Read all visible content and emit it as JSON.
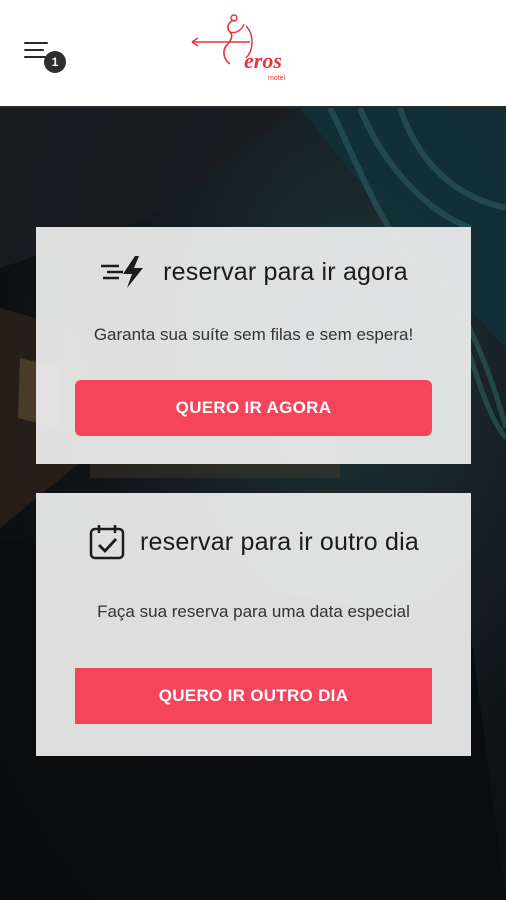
{
  "header": {
    "menu_icon": "menu-icon",
    "notification_count": "1",
    "logo_text": "eros",
    "logo_subtext": "motel",
    "brand_color": "#e4333c"
  },
  "cards": [
    {
      "icon": "lightning-speed-icon",
      "title": "reservar para ir agora",
      "subtitle": "Garanta sua suíte sem filas e sem espera!",
      "button_label": "QUERO IR AGORA"
    },
    {
      "icon": "calendar-check-icon",
      "title": "reservar para ir outro dia",
      "subtitle": "Faça sua reserva para uma data especial",
      "button_label": "QUERO IR OUTRO DIA"
    }
  ],
  "colors": {
    "accent": "#f5455b",
    "card_bg": "#ececec"
  }
}
